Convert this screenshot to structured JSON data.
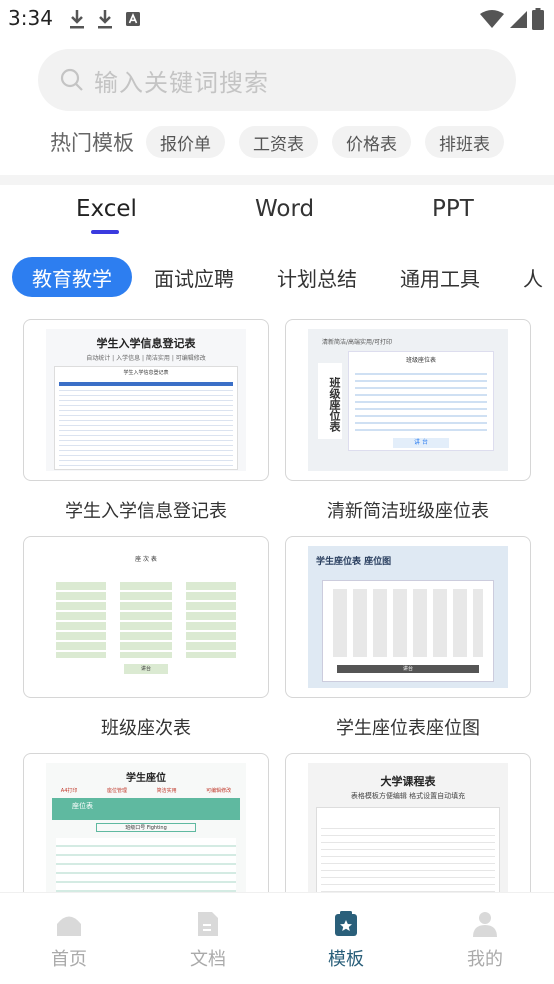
{
  "status": {
    "time": "3:34"
  },
  "search": {
    "placeholder": "输入关键词搜索"
  },
  "hot": {
    "label": "热门模板",
    "chips": [
      "报价单",
      "工资表",
      "价格表",
      "排班表"
    ]
  },
  "type_tabs": [
    "Excel",
    "Word",
    "PPT"
  ],
  "categories": [
    "教育教学",
    "面试应聘",
    "计划总结",
    "通用工具",
    "人"
  ],
  "templates": [
    {
      "title": "学生入学信息登记表",
      "thumb_title": "学生入学信息登记表",
      "thumb_sub": "自动统计 | 入学信息 | 简洁实用 | 可编辑修改",
      "thumb_inner": "学生入学信息登记表"
    },
    {
      "title": "清新简洁班级座位表",
      "thumb_title": "清新简洁/高端实用/可打印",
      "thumb_inner": "班级座位表",
      "thumb_side": "班级座位表",
      "thumb_footer": "讲 台"
    },
    {
      "title": "班级座次表",
      "thumb_title": "座 次 表",
      "thumb_footer": "讲台"
    },
    {
      "title": "学生座位表座位图",
      "thumb_title": "学生座位表 座位图",
      "thumb_footer": "讲台"
    },
    {
      "title": "",
      "thumb_title": "学生座位",
      "thumb_tags": [
        "A4打印",
        "座位管理",
        "简洁实用",
        "可编辑修改"
      ],
      "thumb_banner": "座位表",
      "thumb_slogan": "班级口号 Fighting"
    },
    {
      "title": "",
      "thumb_title": "大学课程表",
      "thumb_sub": "表格模板方便编辑 格式设置自动填充"
    }
  ],
  "nav": [
    {
      "label": "首页",
      "icon": "home-icon",
      "active": false
    },
    {
      "label": "文档",
      "icon": "document-icon",
      "active": false
    },
    {
      "label": "模板",
      "icon": "template-star-icon",
      "active": true
    },
    {
      "label": "我的",
      "icon": "profile-icon",
      "active": false
    }
  ],
  "colors": {
    "accent": "#2d7ef0",
    "tab_indicator": "#3a3adf",
    "nav_active": "#2a5f7a",
    "nav_inactive": "#aaaaaa"
  }
}
